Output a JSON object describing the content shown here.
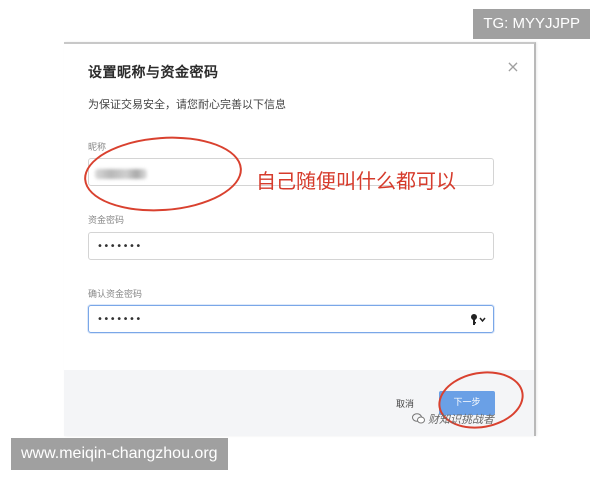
{
  "watermarks": {
    "tg": "TG: MYYJJPP",
    "url": "www.meiqin-changzhou.org",
    "wechat": "财知识挑战者"
  },
  "dialog": {
    "title": "设置昵称与资金密码",
    "subtitle": "为保证交易安全，请您耐心完善以下信息",
    "close_glyph": "×",
    "fields": [
      {
        "label": "昵称",
        "value": ""
      },
      {
        "label": "资金密码",
        "value": "•••••••"
      },
      {
        "label": "确认资金密码",
        "value": "•••••••"
      }
    ],
    "cancel_label": "取消",
    "next_label": "下一步"
  },
  "annotation": {
    "text": "自己随便叫什么都可以"
  },
  "colors": {
    "annotation_red": "#d63b2c",
    "primary_button": "#6aa0e6",
    "focus_border": "#7aa7e8"
  }
}
